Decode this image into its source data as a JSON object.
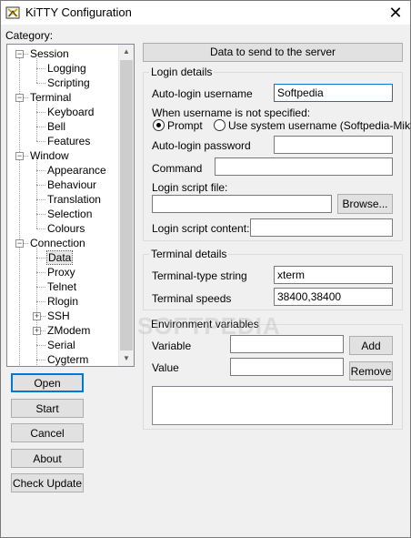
{
  "window": {
    "title": "KiTTY Configuration",
    "close_glyph": "✕"
  },
  "category_label": "Category:",
  "tree": [
    {
      "label": "Session",
      "level": 0,
      "expander": "−"
    },
    {
      "label": "Logging",
      "level": 1
    },
    {
      "label": "Scripting",
      "level": 1
    },
    {
      "label": "Terminal",
      "level": 0,
      "expander": "−"
    },
    {
      "label": "Keyboard",
      "level": 1
    },
    {
      "label": "Bell",
      "level": 1
    },
    {
      "label": "Features",
      "level": 1
    },
    {
      "label": "Window",
      "level": 0,
      "expander": "−"
    },
    {
      "label": "Appearance",
      "level": 1
    },
    {
      "label": "Behaviour",
      "level": 1
    },
    {
      "label": "Translation",
      "level": 1
    },
    {
      "label": "Selection",
      "level": 1
    },
    {
      "label": "Colours",
      "level": 1
    },
    {
      "label": "Connection",
      "level": 0,
      "expander": "−"
    },
    {
      "label": "Data",
      "level": 1,
      "selected": true
    },
    {
      "label": "Proxy",
      "level": 1
    },
    {
      "label": "Telnet",
      "level": 1
    },
    {
      "label": "Rlogin",
      "level": 1
    },
    {
      "label": "SSH",
      "level": 1,
      "expander": "+"
    },
    {
      "label": "ZModem",
      "level": 1,
      "expander": "+"
    },
    {
      "label": "Serial",
      "level": 1
    },
    {
      "label": "Cygterm",
      "level": 1
    }
  ],
  "scroll": {
    "up": "▲",
    "down": "▼"
  },
  "buttons": {
    "open": "Open",
    "start": "Start",
    "cancel": "Cancel",
    "about": "About",
    "check_update": "Check Update"
  },
  "panel_header": "Data to send to the server",
  "login": {
    "group_title": "Login details",
    "autologin_label": "Auto-login username",
    "autologin_value": "Softpedia",
    "when_label": "When username is not specified:",
    "radio_prompt": "Prompt",
    "radio_prompt_checked": true,
    "radio_system": "Use system username (Softpedia-Miki)",
    "password_label": "Auto-login password",
    "password_value": "",
    "command_label": "Command",
    "command_value": "",
    "script_file_label": "Login script file:",
    "script_file_value": "",
    "browse": "Browse...",
    "script_content_label": "Login script content:",
    "script_content_value": ""
  },
  "terminal": {
    "group_title": "Terminal details",
    "type_label": "Terminal-type string",
    "type_value": "xterm",
    "speeds_label": "Terminal speeds",
    "speeds_value": "38400,38400"
  },
  "env": {
    "group_title": "Environment variables",
    "variable_label": "Variable",
    "variable_value": "",
    "value_label": "Value",
    "value_value": "",
    "add": "Add",
    "remove": "Remove"
  },
  "watermark": "SOFTPEDIA"
}
